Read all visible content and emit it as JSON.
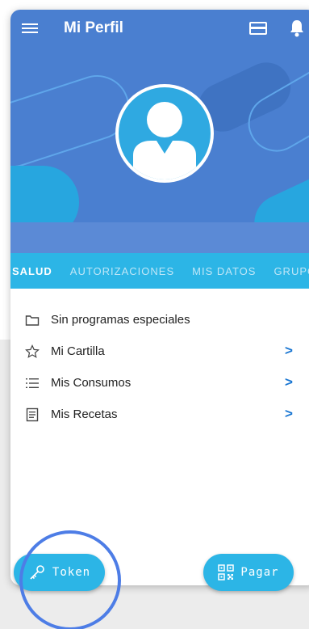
{
  "appbar": {
    "title": "Mi Perfil",
    "menu_icon": "menu-icon",
    "card_icon": "credit-card-icon",
    "bell_icon": "bell-icon"
  },
  "tabs": [
    {
      "label": "SALUD",
      "active": true
    },
    {
      "label": "AUTORIZACIONES",
      "active": false
    },
    {
      "label": "MIS DATOS",
      "active": false
    },
    {
      "label": "GRUPO",
      "active": false
    }
  ],
  "list": [
    {
      "label": "Sin programas especiales",
      "icon": "folder-icon",
      "has_chevron": false
    },
    {
      "label": "Mi Cartilla",
      "icon": "star-icon",
      "has_chevron": true
    },
    {
      "label": "Mis Consumos",
      "icon": "list-icon",
      "has_chevron": true
    },
    {
      "label": "Mis Recetas",
      "icon": "document-icon",
      "has_chevron": true
    }
  ],
  "chevron": ">",
  "fab": {
    "token_label": "Token",
    "token_icon": "key-icon",
    "pagar_label": "Pagar",
    "pagar_icon": "qr-code-icon"
  },
  "colors": {
    "header": "#4a7fd0",
    "tabs": "#2cb5e6",
    "accent": "#1976d2",
    "highlight": "#4d7de6"
  }
}
